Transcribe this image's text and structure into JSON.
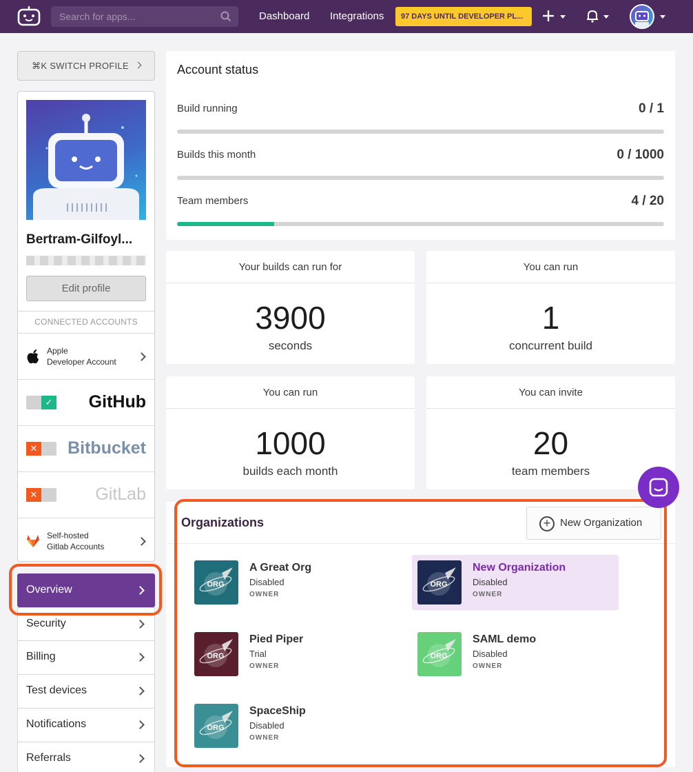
{
  "topbar": {
    "search_placeholder": "Search for apps...",
    "nav": [
      "Dashboard",
      "Integrations"
    ],
    "trial_banner": "97 DAYS UNTIL DEVELOPER PL..."
  },
  "sidebar": {
    "switch_profile": "⌘K  SWITCH PROFILE",
    "username": "Bertram-Gilfoyl...",
    "edit_profile": "Edit profile",
    "connected_accounts_header": "CONNECTED ACCOUNTS",
    "accounts": [
      {
        "label_line1": "Apple",
        "label_line2": "Developer Account",
        "icon": "apple-icon"
      },
      {
        "brand": "GitHub",
        "connected": true
      },
      {
        "brand": "Bitbucket",
        "connected": false
      },
      {
        "brand": "GitLab",
        "connected": false
      },
      {
        "label_line1": "Self-hosted",
        "label_line2": "Gitlab Accounts",
        "icon": "gitlab-fox-icon"
      }
    ],
    "menu": [
      "Overview",
      "Security",
      "Billing",
      "Test devices",
      "Notifications",
      "Referrals"
    ],
    "active_menu": "Overview"
  },
  "account_status": {
    "title": "Account status",
    "rows": [
      {
        "label": "Build running",
        "value": "0 / 1",
        "progress": 0
      },
      {
        "label": "Builds this month",
        "value": "0 / 1000",
        "progress": 0
      },
      {
        "label": "Team members",
        "value": "4 / 20",
        "progress": 0.2
      }
    ]
  },
  "stats": [
    {
      "header": "Your builds can run for",
      "number": "3900",
      "unit": "seconds"
    },
    {
      "header": "You can run",
      "number": "1",
      "unit": "concurrent build"
    },
    {
      "header": "You can run",
      "number": "1000",
      "unit": "builds each month"
    },
    {
      "header": "You can invite",
      "number": "20",
      "unit": "team members"
    }
  ],
  "organizations": {
    "title": "Organizations",
    "new_button": "New Organization",
    "logo_text": "ORG",
    "items": [
      {
        "name": "A Great Org",
        "status": "Disabled",
        "role": "OWNER",
        "color": "#1f6e7a",
        "selected": false
      },
      {
        "name": "New Organization",
        "status": "Disabled",
        "role": "OWNER",
        "color": "#1c2a52",
        "selected": true
      },
      {
        "name": "Pied Piper",
        "status": "Trial",
        "role": "OWNER",
        "color": "#5a1f2d",
        "selected": false
      },
      {
        "name": "SAML demo",
        "status": "Disabled",
        "role": "OWNER",
        "color": "#66d07a",
        "selected": false
      },
      {
        "name": "SpaceShip",
        "status": "Disabled",
        "role": "OWNER",
        "color": "#3a8f94",
        "selected": false
      }
    ]
  },
  "colors": {
    "accent": "#4b2b5e",
    "highlight": "#f15a1f",
    "progress": "#1db88a",
    "banner": "#fdc82b"
  }
}
